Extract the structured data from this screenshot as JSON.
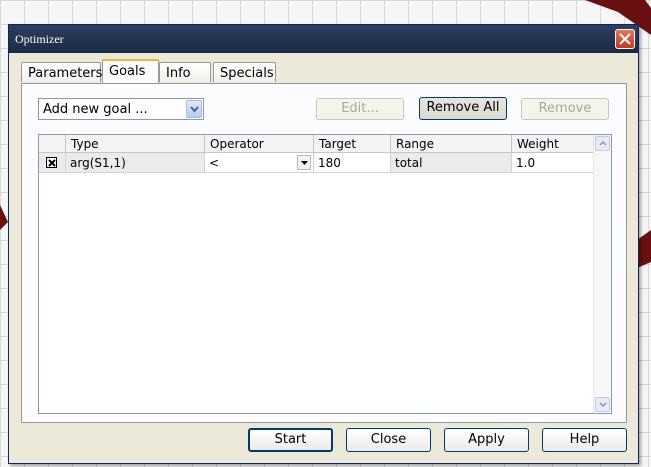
{
  "window": {
    "title": "Optimizer"
  },
  "tabs": [
    {
      "label": "Parameters"
    },
    {
      "label": "Goals"
    },
    {
      "label": "Info"
    },
    {
      "label": "Specials"
    }
  ],
  "toolbar": {
    "add_goal_select": "Add new goal ...",
    "edit_label": "Edit...",
    "remove_all_label": "Remove All",
    "remove_label": "Remove"
  },
  "table": {
    "columns": [
      "Type",
      "Operator",
      "Target",
      "Range",
      "Weight"
    ],
    "rows": [
      {
        "type": "arg(S1,1)",
        "operator": "<",
        "target": "180",
        "range": "total",
        "weight": "1.0"
      }
    ]
  },
  "buttons": {
    "start": "Start",
    "close": "Close",
    "apply": "Apply",
    "help": "Help"
  },
  "colors": {
    "titlebar": "#1b2a45",
    "close_button": "#c8391b",
    "canvas_shape": "#6b1010",
    "tab_highlight": "#f5b43b"
  }
}
